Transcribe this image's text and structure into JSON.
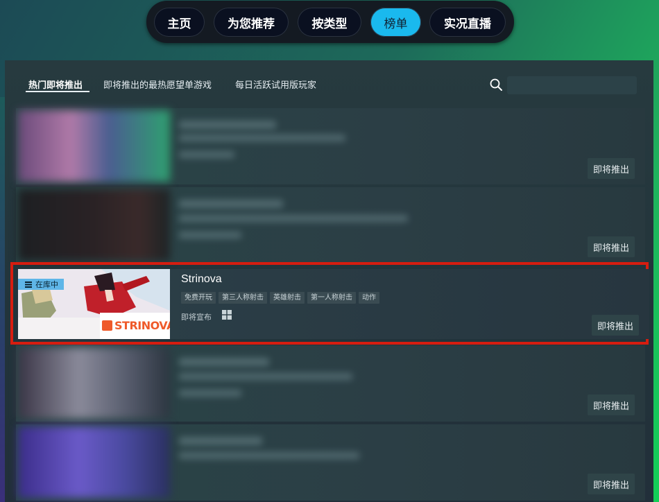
{
  "nav": {
    "items": [
      {
        "label": "主页"
      },
      {
        "label": "为您推荐"
      },
      {
        "label": "按类型"
      },
      {
        "label": "榜单",
        "active": true
      },
      {
        "label": "实况直播"
      }
    ]
  },
  "tabs": [
    {
      "label": "热门即将推出",
      "active": true
    },
    {
      "label": "即将推出的最热愿望单游戏"
    },
    {
      "label": "每日活跃试用版玩家"
    }
  ],
  "search": {
    "placeholder": ""
  },
  "rows": [
    {
      "button": "即将推出"
    },
    {
      "button": "即将推出"
    },
    {
      "button": "即将推出"
    },
    {
      "button": "即将推出"
    }
  ],
  "featured": {
    "title": "Strinova",
    "library_badge": "在库中",
    "logo_text": "STRINOVA",
    "tags": [
      "免费开玩",
      "第三人称射击",
      "英雄射击",
      "第一人称射击",
      "动作"
    ],
    "release": "即将宣布",
    "platform_icon": "windows-icon",
    "button": "即将推出"
  },
  "colors": {
    "accent": "#1ab9ee",
    "highlight": "#d61d10",
    "badge": "#5fb6e8"
  }
}
